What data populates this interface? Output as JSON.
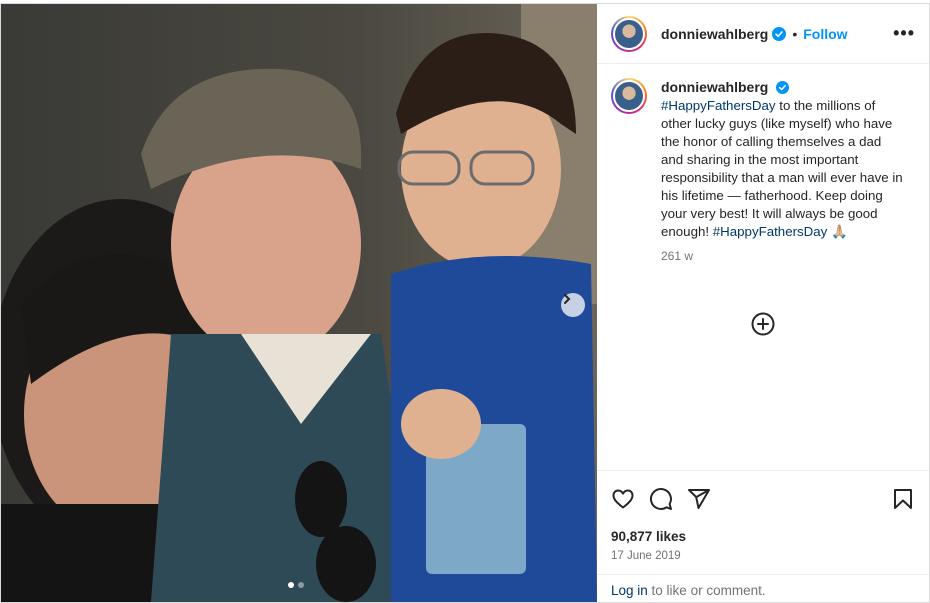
{
  "post": {
    "username": "donniewahlberg",
    "follow_label": "Follow",
    "more_label": "•••",
    "separator": "•",
    "caption": {
      "hashtag_start": "#HappyFathersDay",
      "body": " to the millions of other lucky guys (like myself) who have the honor of calling themselves a dad and sharing in the most important responsibility that a man will ever have in his lifetime — fatherhood. Keep doing your very best! It will always be good enough! ",
      "hashtag_end": "#HappyFathersDay",
      "emoji": "🙏🏼",
      "time": "261 w"
    },
    "likes": "90,877 likes",
    "date": "17 June 2019",
    "login": {
      "link": "Log in",
      "rest": " to like or comment."
    },
    "carousel": {
      "slides": 2,
      "current": 1
    },
    "colors": {
      "accent": "#0095f6",
      "hashtag": "#00376b",
      "muted": "#737373",
      "verified": "#0095f6"
    }
  }
}
